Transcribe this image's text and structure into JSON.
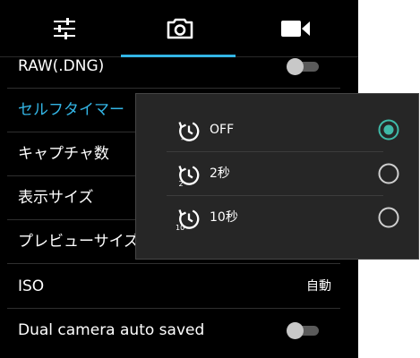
{
  "tabs": [
    {
      "name": "settings",
      "icon": "sliders-icon"
    },
    {
      "name": "camera",
      "icon": "camera-icon",
      "active": true
    },
    {
      "name": "video",
      "icon": "video-camera-icon"
    }
  ],
  "settings": {
    "raw": {
      "label": "RAW(.DNG)",
      "enabled": false
    },
    "self_timer": {
      "label": "セルフタイマー"
    },
    "capture_count": {
      "label": "キャプチャ数"
    },
    "display_size": {
      "label": "表示サイズ"
    },
    "preview_size": {
      "label": "プレビューサイズ"
    },
    "iso": {
      "label": "ISO",
      "value": "自動"
    },
    "dual_camera": {
      "label": "Dual camera auto saved",
      "enabled": false
    }
  },
  "timer_dialog": {
    "options": [
      {
        "label": "OFF",
        "icon_text": "-",
        "selected": true
      },
      {
        "label": "2秒",
        "icon_text": "2",
        "selected": false
      },
      {
        "label": "10秒",
        "icon_text": "10",
        "selected": false
      }
    ]
  },
  "colors": {
    "accent": "#33b5e5",
    "background": "#000000",
    "dialog_background": "#262626",
    "toggle_off_track": "#5a5a5a"
  }
}
